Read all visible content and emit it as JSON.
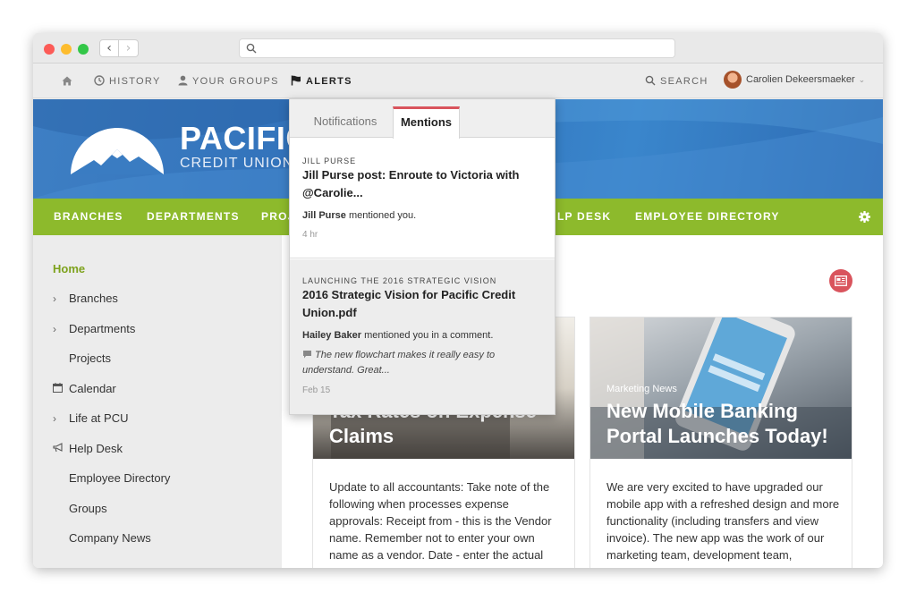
{
  "topnav": {
    "history": "HISTORY",
    "groups": "YOUR GROUPS",
    "alerts": "ALERTS",
    "search": "SEARCH",
    "user_name": "Carolien Dekeersmaeker"
  },
  "banner": {
    "logo_name": "PACIFIC",
    "logo_sub": "CREDIT UNION"
  },
  "greennav": {
    "branches": "BRANCHES",
    "departments": "DEPARTMENTS",
    "projects": "PROJ",
    "helpdesk": "LP DESK",
    "directory": "EMPLOYEE DIRECTORY"
  },
  "sidebar": {
    "items": [
      {
        "label": "Home"
      },
      {
        "label": "Branches"
      },
      {
        "label": "Departments"
      },
      {
        "label": "Projects"
      },
      {
        "label": "Calendar"
      },
      {
        "label": "Life at PCU"
      },
      {
        "label": "Help Desk"
      },
      {
        "label": "Employee Directory"
      },
      {
        "label": "Groups"
      },
      {
        "label": "Company News"
      }
    ]
  },
  "cards": [
    {
      "title": "Tax Rates on Expense Claims",
      "body": "Update to all accountants: Take note of the following when processes expense approvals: Receipt from - this is the Vendor name. Remember not to enter your own name as a vendor. Date - enter the actual"
    },
    {
      "category": "Marketing News",
      "title": "New Mobile Banking Portal Launches Today!",
      "body": "We are very excited to have upgraded our mobile app with a refreshed design and more functionality (including transfers and view invoice). The new app was the work of our marketing team, development team,"
    }
  ],
  "dropdown": {
    "tab_notifications": "Notifications",
    "tab_mentions": "Mentions",
    "items": [
      {
        "kicker": "JILL PURSE",
        "title": "Jill Purse post: Enroute to Victoria with @Carolie...",
        "actor": "Jill Purse",
        "action": "mentioned you.",
        "time": "4 hr"
      },
      {
        "kicker": "LAUNCHING THE 2016 STRATEGIC VISION",
        "title": "2016 Strategic Vision for Pacific Credit Union.pdf",
        "actor": "Hailey Baker",
        "action": "mentioned you in a comment.",
        "quote": "The new flowchart makes it really easy to understand. Great...",
        "time": "Feb 15"
      }
    ]
  },
  "colors": {
    "brand_blue": "#3e7fc4",
    "nav_green": "#8dba2c",
    "accent_red": "#d9545d",
    "home_green": "#7ea21d"
  }
}
